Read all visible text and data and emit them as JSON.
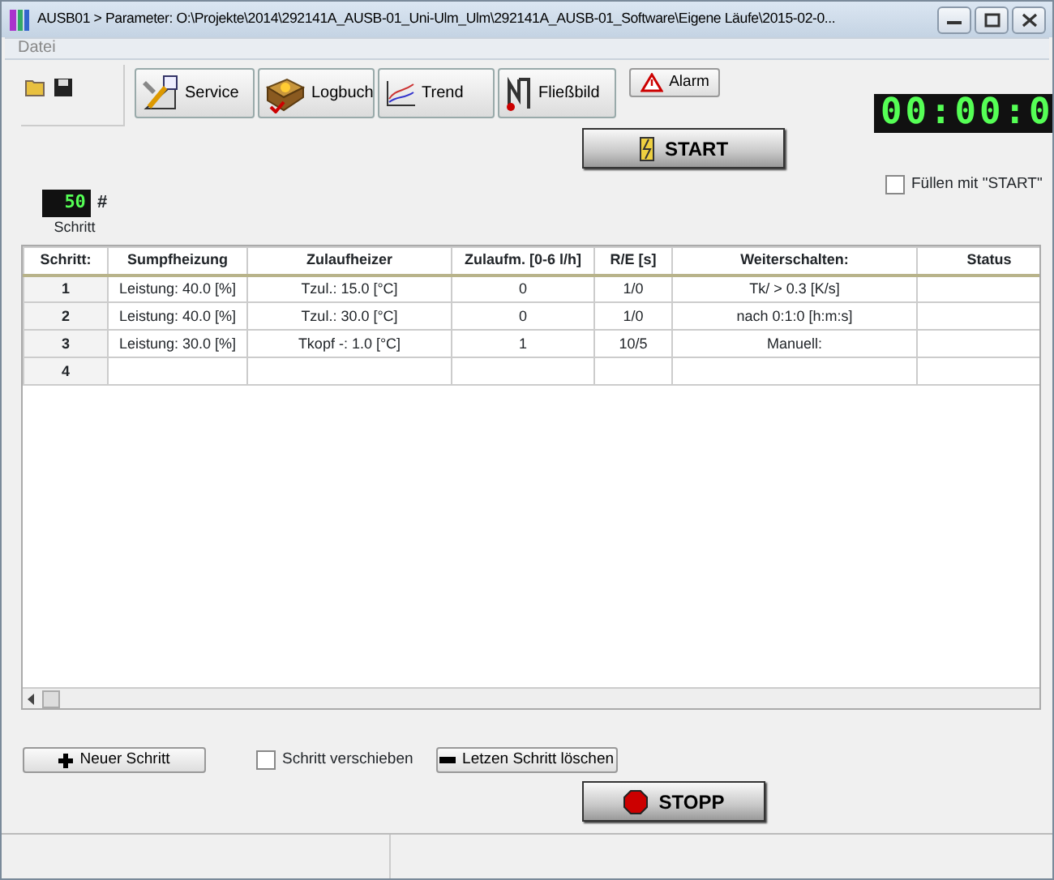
{
  "window": {
    "title": "AUSB01 > Parameter: O:\\Projekte\\2014\\292141A_AUSB-01_Uni-Ulm_Ulm\\292141A_AUSB-01_Software\\Eigene Läufe\\2015-02-0..."
  },
  "menu": [
    "Datei"
  ],
  "toolbar": [
    {
      "kind": "service",
      "label": "Service"
    },
    {
      "kind": "logbook",
      "label": "Logbuch"
    },
    {
      "kind": "trend",
      "label": "Trend"
    },
    {
      "kind": "flow",
      "label": "Fließbild"
    }
  ],
  "alarm_button": "Alarm",
  "timer": "00:00:0",
  "start_button": "START",
  "fill_checkbox": {
    "label": "Füllen mit \"START\"",
    "checked": false
  },
  "step_counter": {
    "value": "50",
    "unit": "#",
    "label": "Schritt"
  },
  "table": {
    "columns": [
      "Schritt:",
      "Sumpfheizung",
      "Zulaufheizer",
      "Zulaufm. [0-6 l/h]",
      "R/E [s]",
      "Weiterschalten:",
      "Status"
    ],
    "rows": [
      [
        "1",
        "Leistung: 40.0 [%]",
        "Tzul.: 15.0 [°C]",
        "0",
        "1/0",
        "Tk/ > 0.3 [K/s]",
        ""
      ],
      [
        "2",
        "Leistung: 40.0 [%]",
        "Tzul.: 30.0 [°C]",
        "0",
        "1/0",
        "nach 0:1:0 [h:m:s]",
        ""
      ],
      [
        "3",
        "Leistung: 30.0 [%]",
        "Tkopf -: 1.0 [°C]",
        "1",
        "10/5",
        "Manuell:",
        ""
      ],
      [
        "4",
        "",
        "",
        "",
        "",
        "",
        ""
      ]
    ]
  },
  "new_step_button": "Neuer Schritt",
  "move_checkbox": {
    "label": "Schritt verschieben",
    "checked": false
  },
  "delete_button": "Letzen Schritt löschen",
  "stop_button": "STOPP"
}
